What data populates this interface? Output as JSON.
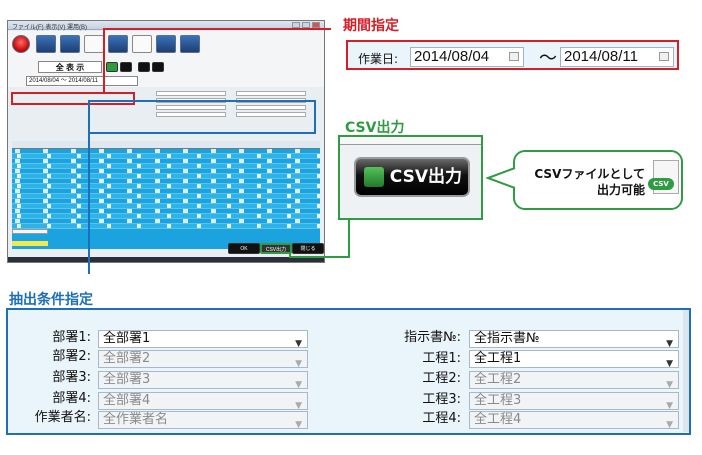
{
  "thumbnail": {
    "title": "ファイル(F) 表示(V) 運用(B)",
    "title_text": "全 表 示",
    "date_range": "2014/08/04 ～ 2014/08/11",
    "buttons": {
      "export": "CSV出力",
      "close": "閉じる",
      "ok": "OK"
    }
  },
  "period": {
    "callout_label": "期間指定",
    "field_label": "作業日:",
    "start_date": "2014/08/04",
    "separator": "～",
    "end_date": "2014/08/11"
  },
  "csv": {
    "callout_label": "CSV出力",
    "button_label": "CSV出力",
    "bubble_text_line1": "CSVファイルとして",
    "bubble_text_line2": "出力可能",
    "file_badge": "CSV"
  },
  "filter": {
    "callout_label": "抽出条件指定",
    "left_fields": [
      {
        "label": "部署1:",
        "value": "全部署1",
        "enabled": true
      },
      {
        "label": "部署2:",
        "value": "全部署2",
        "enabled": false
      },
      {
        "label": "部署3:",
        "value": "全部署3",
        "enabled": false
      },
      {
        "label": "部署4:",
        "value": "全部署4",
        "enabled": false
      },
      {
        "label": "作業者名:",
        "value": "全作業者名",
        "enabled": false
      }
    ],
    "right_fields": [
      {
        "label": "指示書№:",
        "value": "全指示書№",
        "enabled": true
      },
      {
        "label": "工程1:",
        "value": "全工程1",
        "enabled": true
      },
      {
        "label": "工程2:",
        "value": "全工程2",
        "enabled": false
      },
      {
        "label": "工程3:",
        "value": "全工程3",
        "enabled": false
      },
      {
        "label": "工程4:",
        "value": "全工程4",
        "enabled": false
      }
    ]
  },
  "colors": {
    "red": "#d41f26",
    "green": "#2f9c43",
    "blue": "#1d6fb8",
    "grid": "#1aa3de"
  }
}
